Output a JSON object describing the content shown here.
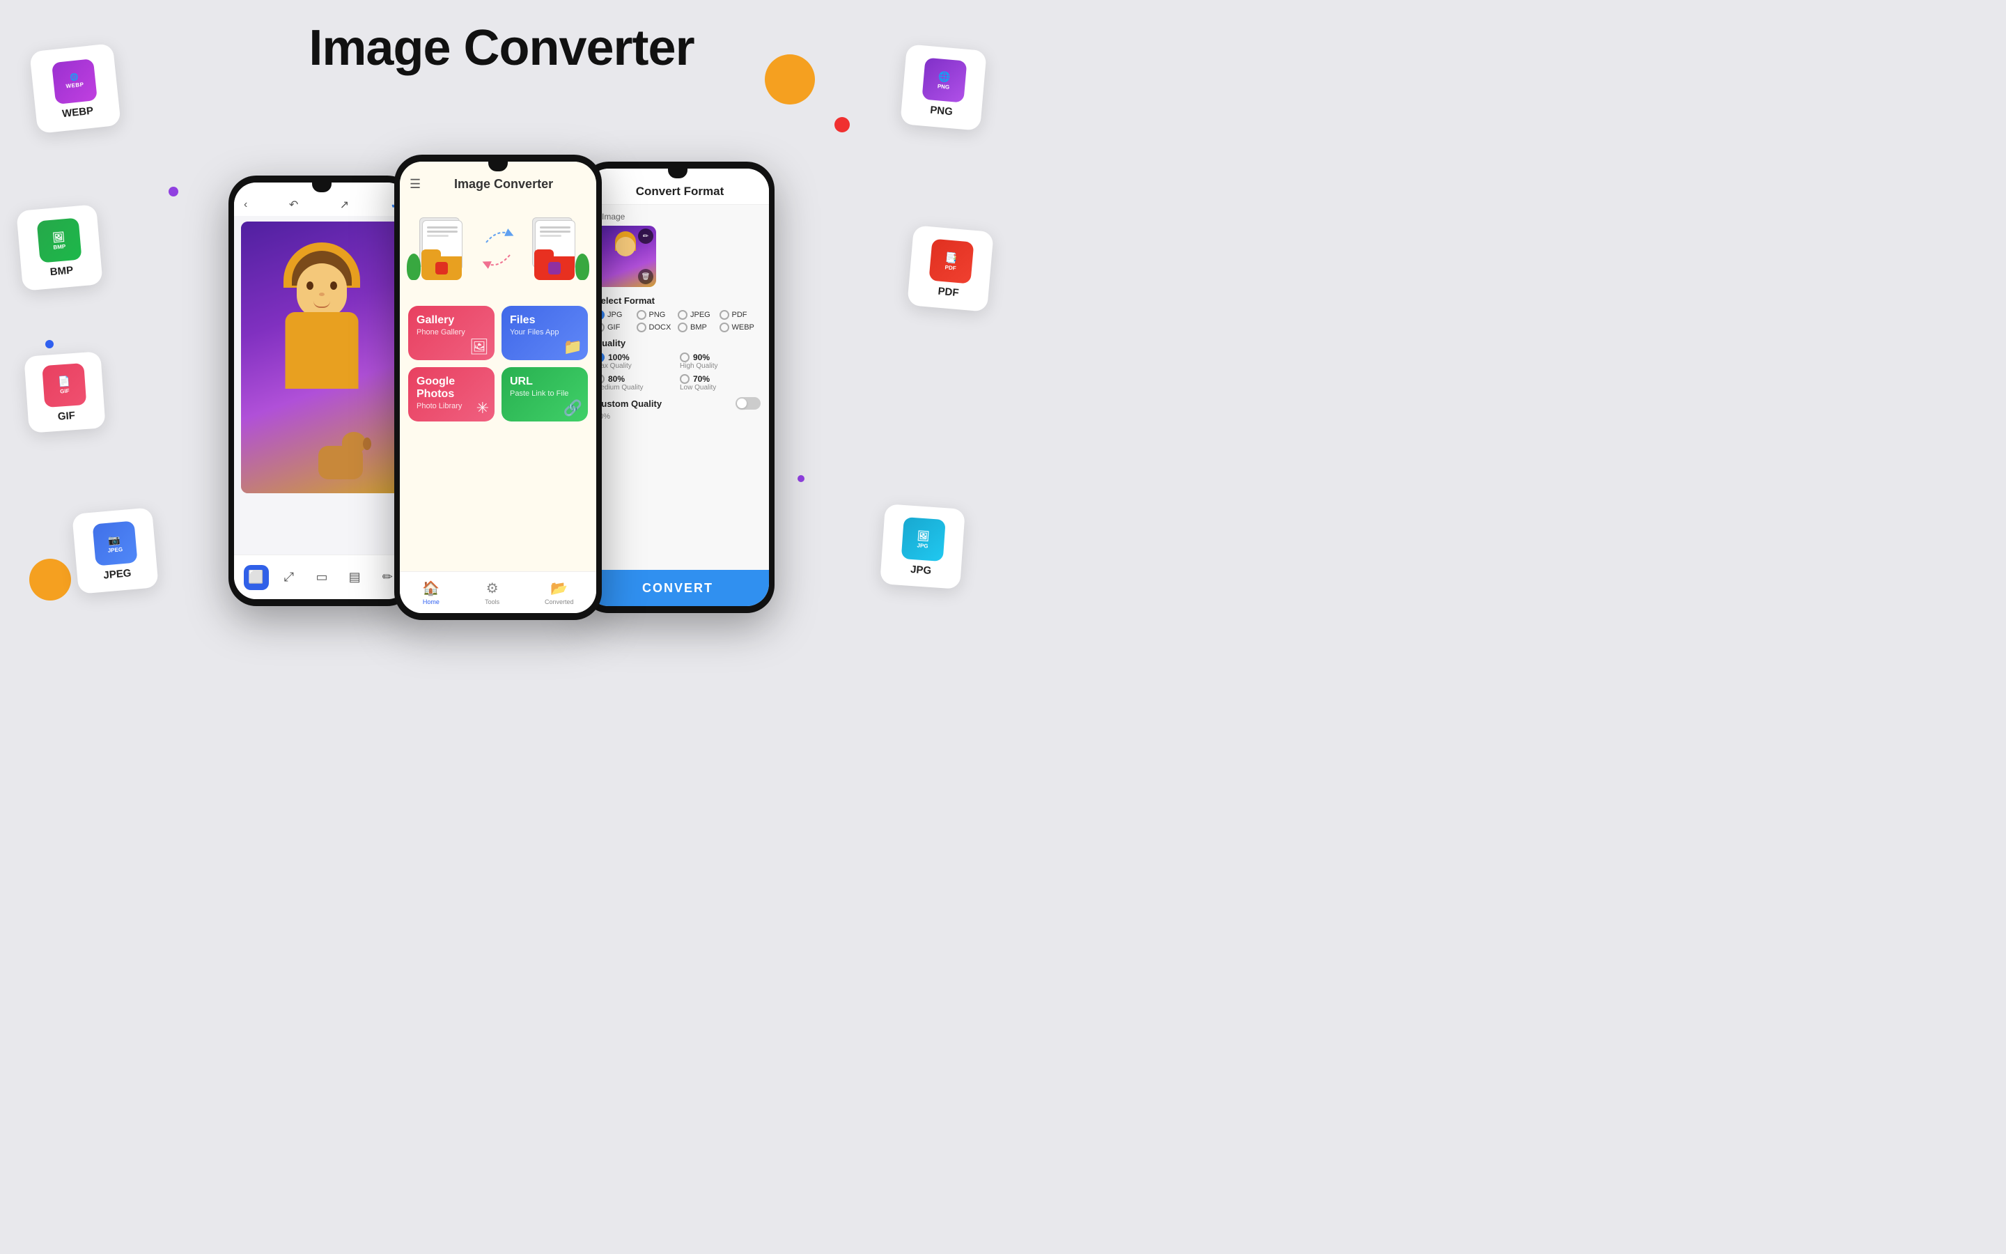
{
  "page": {
    "title": "Image Converter",
    "background_color": "#e8e8ec"
  },
  "format_cards": {
    "webp": {
      "label": "WEBP",
      "color_start": "#9b30d0",
      "color_end": "#c040e0"
    },
    "bmp": {
      "label": "BMP",
      "color_start": "#26a84a",
      "color_end": "#1db84a"
    },
    "gif": {
      "label": "GIF",
      "color_start": "#e84060",
      "color_end": "#f05070"
    },
    "jpeg": {
      "label": "JPEG",
      "color_start": "#4070e8",
      "color_end": "#5088f8"
    },
    "png": {
      "label": "PNG",
      "color_start": "#8030c8",
      "color_end": "#b050e8"
    },
    "pdf": {
      "label": "PDF",
      "color_start": "#e03020",
      "color_end": "#f04030"
    },
    "jpg": {
      "label": "JPG",
      "color_start": "#18a8d0",
      "color_end": "#20c8f0"
    }
  },
  "left_phone": {
    "toolbar": {
      "back": "‹",
      "undo": "↶",
      "share": "↗",
      "check": "✓"
    },
    "tools": [
      "⬜",
      "⤢",
      "▭",
      "▤",
      "✏"
    ]
  },
  "center_phone": {
    "header_title": "Image Converter",
    "menu_items": [
      {
        "title": "Gallery",
        "subtitle": "Phone Gallery",
        "type": "gallery"
      },
      {
        "title": "Files",
        "subtitle": "Your Files App",
        "type": "files"
      },
      {
        "title": "Google Photos",
        "subtitle": "Photo Library",
        "type": "gphotos"
      },
      {
        "title": "URL",
        "subtitle": "Paste Link to File",
        "type": "url"
      }
    ],
    "nav_items": [
      {
        "label": "Home",
        "active": true
      },
      {
        "label": "Tools",
        "active": false
      },
      {
        "label": "Converted",
        "active": false
      }
    ]
  },
  "right_phone": {
    "header_title": "Convert Format",
    "back": "‹",
    "image_count": "1 Image",
    "formats": [
      "JPG",
      "PNG",
      "JPEG",
      "PDF",
      "GIF",
      "DOCX",
      "BMP",
      "WEBP"
    ],
    "selected_format": "JPG",
    "quality_options": [
      {
        "value": "100%",
        "desc": "Max Quality",
        "selected": true
      },
      {
        "value": "90%",
        "desc": "High Quality",
        "selected": false
      },
      {
        "value": "80%",
        "desc": "Medium Quality",
        "selected": false
      },
      {
        "value": "70%",
        "desc": "Low Quality",
        "selected": false
      }
    ],
    "custom_quality_label": "Custom Quality",
    "custom_quality_value": "50%",
    "convert_btn": "CONVERT"
  }
}
